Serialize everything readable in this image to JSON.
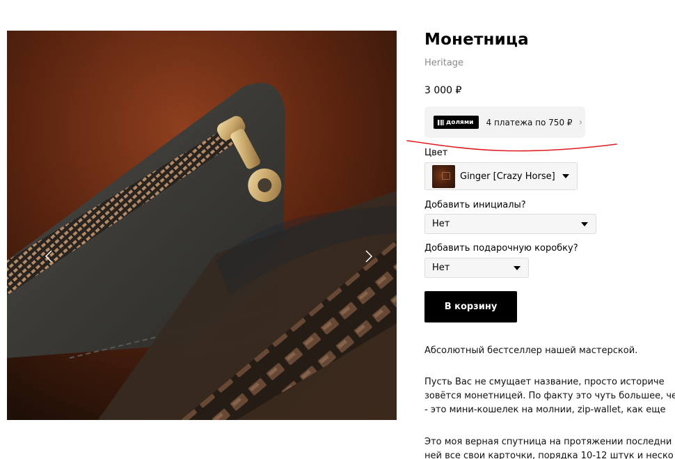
{
  "product": {
    "title": "Монетница",
    "brand": "Heritage",
    "price": "3 000 ₽"
  },
  "installments": {
    "logo_text": "долями",
    "text": "4 платежа по 750 ₽",
    "chevron": "›"
  },
  "options": {
    "color": {
      "label": "Цвет",
      "value": "Ginger [Crazy Horse]"
    },
    "initials": {
      "label": "Добавить инициалы?",
      "value": "Нет"
    },
    "gift_box": {
      "label": "Добавить подарочную коробку?",
      "value": "Нет"
    }
  },
  "cart": {
    "button_label": "В корзину"
  },
  "description": {
    "paragraphs": [
      [
        "Абсолютный бестселлер нашей мастерской."
      ],
      [
        "Пусть Вас не смущает название, просто историче",
        "зовётся монетницей. По факту это чуть большее, че",
        "- это мини-кошелек на молнии, zip-wallet, как еще"
      ],
      [
        "Это моя верная спутница на протяжении последни",
        "ней все свои карточки, порядка 10-12 штук и неско"
      ]
    ]
  },
  "gallery": {
    "prev_icon": "chevron-left-icon",
    "next_icon": "chevron-right-icon"
  },
  "colors": {
    "annotation_stroke": "#e0191e",
    "button_bg": "#000000",
    "installments_bg": "#f3f3f3",
    "brand_text": "#8a8a8a"
  }
}
